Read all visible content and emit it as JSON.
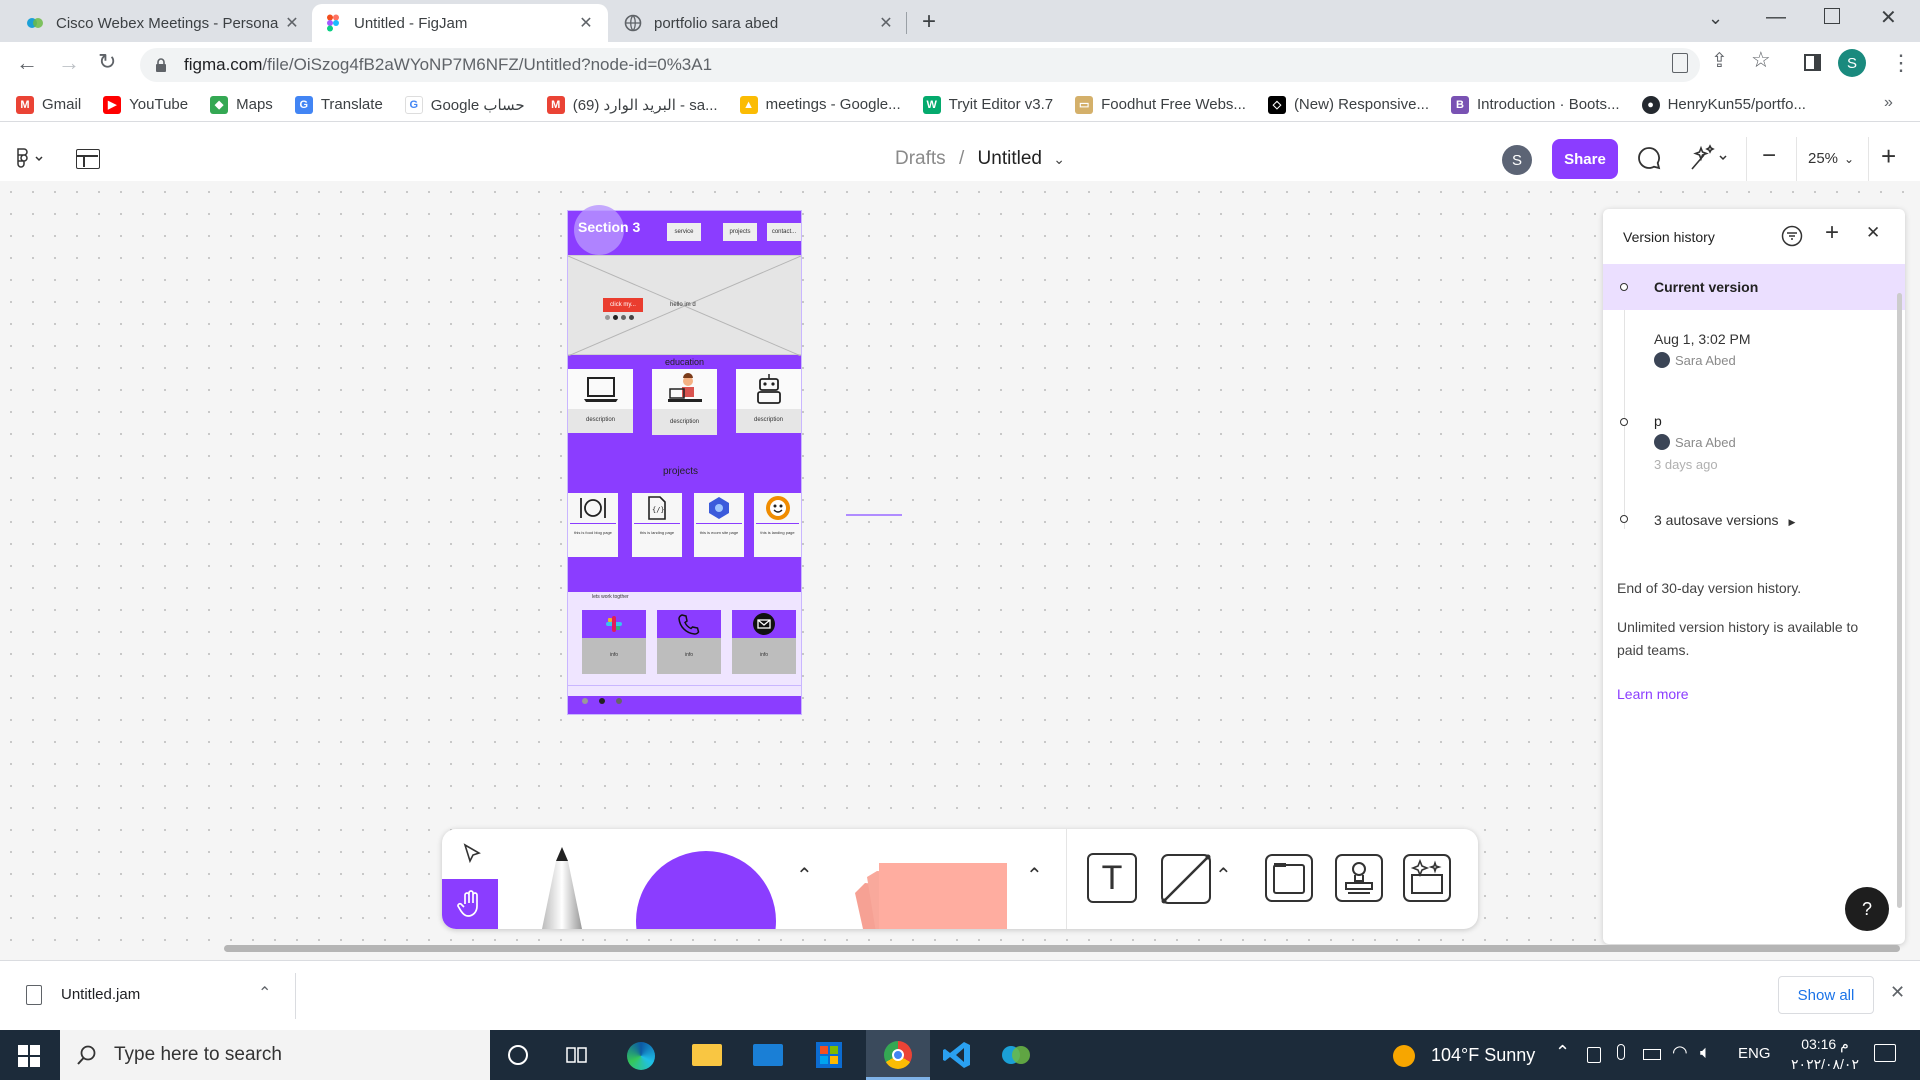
{
  "browser": {
    "tabs": [
      {
        "title": "Cisco Webex Meetings - Persona",
        "active": false
      },
      {
        "title": "Untitled - FigJam",
        "active": true
      },
      {
        "title": "portfolio sara abed",
        "active": false
      }
    ],
    "url_host": "figma.com",
    "url_path": "/file/OiSzog4fB2aWYoNP7M6NFZ/Untitled?node-id=0%3A1",
    "profile_initial": "S",
    "bookmarks": [
      {
        "label": "Gmail",
        "color": "#ea4335"
      },
      {
        "label": "YouTube",
        "color": "#ff0000"
      },
      {
        "label": "Maps",
        "color": "#34a853"
      },
      {
        "label": "Translate",
        "color": "#4285f4"
      },
      {
        "label": "Google حساب",
        "color": "#4285f4"
      },
      {
        "label": "البريد الوارد (69) - sa...",
        "color": "#ea4335"
      },
      {
        "label": "meetings - Google...",
        "color": "#fbbc04"
      },
      {
        "label": "Tryit Editor v3.7",
        "color": "#04aa6d"
      },
      {
        "label": "Foodhut Free Webs...",
        "color": "#d4b06a"
      },
      {
        "label": "(New) Responsive...",
        "color": "#000000"
      },
      {
        "label": "Introduction · Boots...",
        "color": "#7952b3"
      },
      {
        "label": "HenryKun55/portfo...",
        "color": "#24292f"
      }
    ]
  },
  "figjam": {
    "breadcrumb_drafts": "Drafts",
    "breadcrumb_sep": "/",
    "file_name": "Untitled",
    "avatar_initial": "S",
    "share_label": "Share",
    "zoom": "25%",
    "accent": "#8b3dff"
  },
  "frame": {
    "section_label": "Section 3",
    "nav": [
      "service",
      "projects",
      "contact..."
    ],
    "hero_button": "click my...",
    "hero_text": "hello im d",
    "education_title": "education",
    "edu_cards": [
      "description",
      "description",
      "description"
    ],
    "projects_title": "projects",
    "project_cards": [
      "this is food blog page",
      "this is landing page",
      "this is ecom site page",
      "this is landing page"
    ],
    "contact_title": "lets work togther",
    "contact_cards": [
      "info",
      "info",
      "info"
    ]
  },
  "version_history": {
    "title": "Version history",
    "current": "Current version",
    "versions": [
      {
        "title": "Aug 1, 3:02 PM",
        "author": "Sara Abed",
        "time": ""
      },
      {
        "title": "p",
        "author": "Sara Abed",
        "time": "3 days ago"
      }
    ],
    "autosave": "3 autosave versions",
    "end_note": "End of 30-day version history.",
    "unlimited_note": "Unlimited version history is available to paid teams.",
    "learn_more": "Learn more",
    "help": "?"
  },
  "downloads": {
    "file": "Untitled.jam",
    "show_all": "Show all"
  },
  "taskbar": {
    "search_placeholder": "Type here to search",
    "weather": "104°F  Sunny",
    "lang": "ENG",
    "time": "03:16 م",
    "date": "٢٠٢٢/٠٨/٠٢"
  }
}
